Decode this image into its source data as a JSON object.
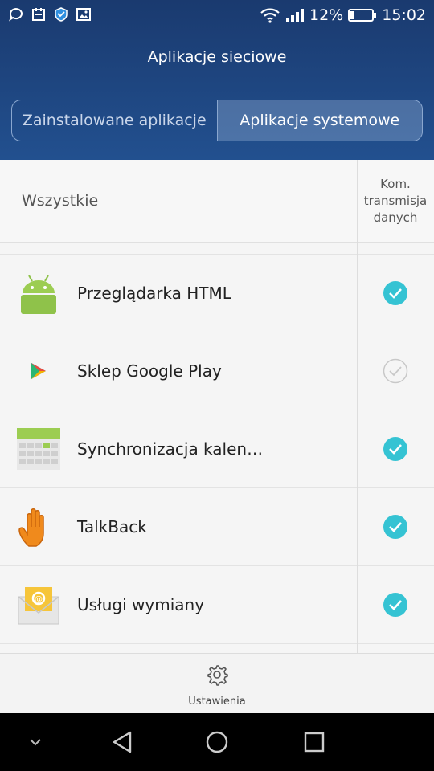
{
  "status_bar": {
    "battery": "12%",
    "time": "15:02",
    "icons": [
      "chat-icon",
      "calendar-icon",
      "shield-icon",
      "image-icon",
      "wifi-icon",
      "signal-icon",
      "battery-icon"
    ]
  },
  "header": {
    "title": "Aplikacje sieciowe",
    "tabs": [
      {
        "label": "Zainstalowane aplikacje",
        "active": false
      },
      {
        "label": "Aplikacje systemowe",
        "active": true
      }
    ]
  },
  "columns": {
    "left": "Wszystkie",
    "right_line1": "Kom.",
    "right_line2": "transmisja",
    "right_line3": "danych"
  },
  "apps": [
    {
      "name": "Przeglądarka HTML",
      "icon": "android-icon",
      "checked": true
    },
    {
      "name": "Sklep Google Play",
      "icon": "play-store-icon",
      "checked": false
    },
    {
      "name": "Synchronizacja kalen…",
      "icon": "calendar-sync-icon",
      "checked": true
    },
    {
      "name": "TalkBack",
      "icon": "hand-icon",
      "checked": true
    },
    {
      "name": "Usługi wymiany",
      "icon": "email-exchange-icon",
      "checked": true
    }
  ],
  "bottom": {
    "settings_label": "Ustawienia"
  },
  "colors": {
    "header_top": "#1a3a6f",
    "header_bottom": "#22508f",
    "check_teal": "#35c3d3",
    "check_gray": "#c8c8c8"
  }
}
